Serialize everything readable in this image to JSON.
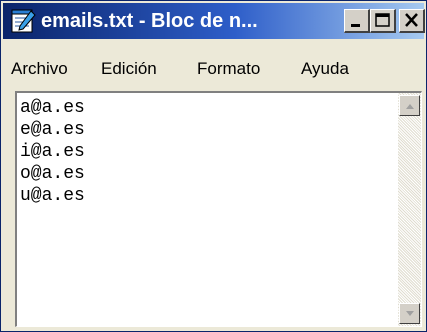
{
  "window": {
    "title": "emails.txt - Bloc de n...",
    "icon": "notepad-icon",
    "controls": [
      "minimize-icon",
      "maximize-icon",
      "close-icon"
    ]
  },
  "menu": {
    "items": [
      {
        "label": "Archivo"
      },
      {
        "label": "Edición"
      },
      {
        "label": "Formato"
      },
      {
        "label": "Ayuda"
      }
    ]
  },
  "editor": {
    "lines": [
      "a@a.es",
      "e@a.es",
      "i@a.es",
      "o@a.es",
      "u@a.es"
    ]
  },
  "scrollbar": {
    "up_icon": "scroll-up-arrow-icon",
    "down_icon": "scroll-down-arrow-icon"
  }
}
